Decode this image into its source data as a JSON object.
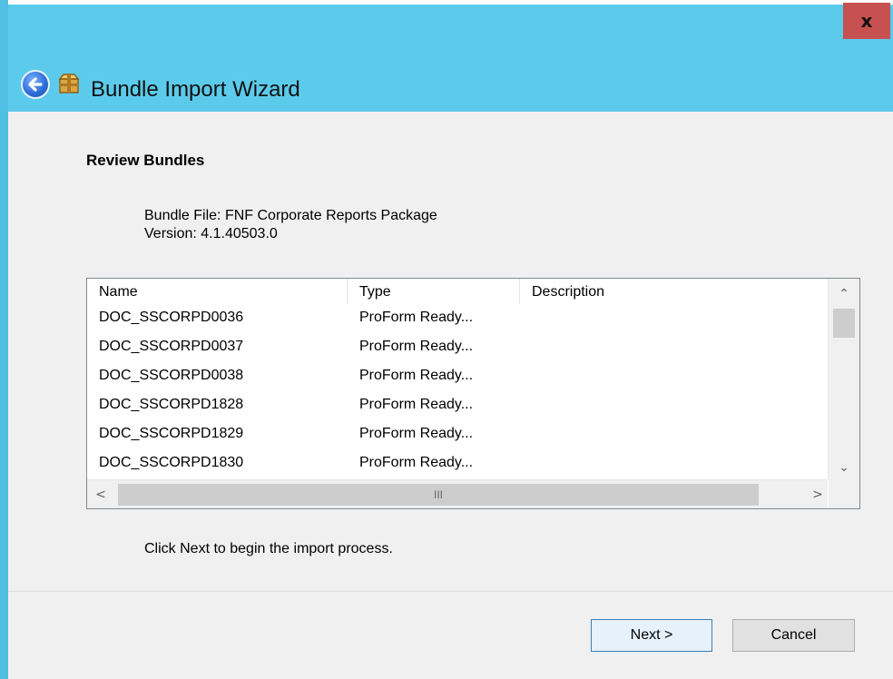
{
  "window": {
    "close_label": "x"
  },
  "header": {
    "title": "Bundle Import Wizard",
    "back_icon": "back-arrow-icon",
    "app_icon": "package-box-icon"
  },
  "content": {
    "section_title": "Review Bundles",
    "bundle_file": "Bundle File: FNF Corporate Reports Package",
    "version": "Version: 4.1.40503.0",
    "list": {
      "columns": [
        "Name",
        "Type",
        "Description"
      ],
      "rows": [
        {
          "name": "DOC_SSCORPD0036",
          "type": "ProForm Ready..."
        },
        {
          "name": "DOC_SSCORPD0037",
          "type": "ProForm Ready..."
        },
        {
          "name": "DOC_SSCORPD0038",
          "type": "ProForm Ready..."
        },
        {
          "name": "DOC_SSCORPD1828",
          "type": "ProForm Ready..."
        },
        {
          "name": "DOC_SSCORPD1829",
          "type": "ProForm Ready..."
        },
        {
          "name": "DOC_SSCORPD1830",
          "type": "ProForm Ready..."
        }
      ],
      "hscroll_grip": "III"
    },
    "instruction": "Click Next to begin the import process."
  },
  "footer": {
    "next_label": "Next >",
    "cancel_label": "Cancel"
  },
  "colors": {
    "title_bar": "#5ccbeb",
    "close_button": "#c75050",
    "content_bg": "#f0f0f0"
  }
}
